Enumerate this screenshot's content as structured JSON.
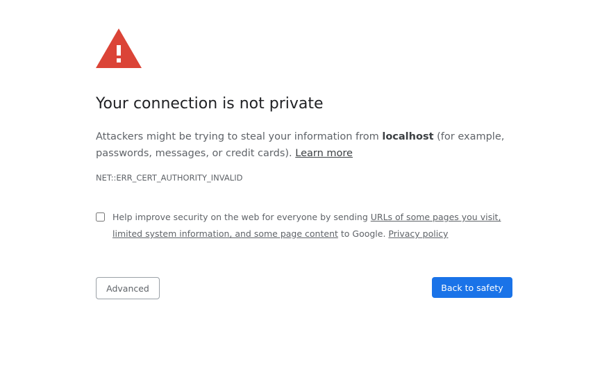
{
  "interstitial": {
    "icon": "warning-triangle-icon",
    "icon_color": "#db4437",
    "title": "Your connection is not private",
    "message": {
      "before_host": "Attackers might be trying to steal your information from ",
      "host": "localhost",
      "after_host": " (for example, passwords, messages, or credit cards). ",
      "learn_more": "Learn more"
    },
    "error_code": "NET::ERR_CERT_AUTHORITY_INVALID",
    "optin": {
      "checked": false,
      "text_before": "Help improve security on the web for everyone by sending ",
      "data_link": "URLs of some pages you visit, limited system information, and some page content",
      "text_middle": " to Google. ",
      "privacy_link": "Privacy policy"
    },
    "buttons": {
      "advanced": "Advanced",
      "back_to_safety": "Back to safety",
      "primary_color": "#1a73e8"
    }
  }
}
